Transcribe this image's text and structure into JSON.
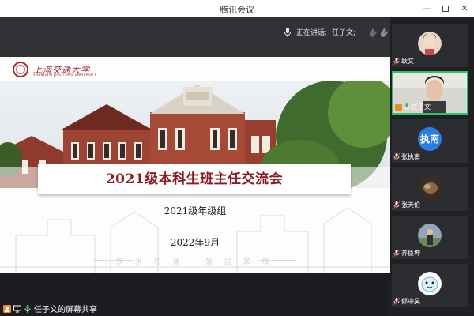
{
  "window": {
    "title": "腾讯会议"
  },
  "topbar": {
    "speaking_prefix": "正在讲话:",
    "speaking_name": "任子文;"
  },
  "slide": {
    "school_name": "上海交通大学",
    "school_name_en": "SHANGHAI JIAO TONG UNIVERSITY",
    "main_title": "2021级本科生班主任交流会",
    "subtitle": "2021级年级组",
    "date": "2022年9月",
    "motto": "饮 水 思 源 · 爱 国 荣 校"
  },
  "share": {
    "label": "任子文的屏幕共享"
  },
  "participants": [
    {
      "name": "耿文",
      "avatar": "photo",
      "active": false
    },
    {
      "name": "任子文",
      "avatar": "photo",
      "active": true
    },
    {
      "name": "张执南",
      "avatar": "text",
      "avatar_text": "执南",
      "active": false
    },
    {
      "name": "张天伦",
      "avatar": "photo",
      "active": false
    },
    {
      "name": "齐臣坤",
      "avatar": "photo",
      "active": false
    },
    {
      "name": "郁中昊",
      "avatar": "cartoon",
      "active": false
    }
  ],
  "colors": {
    "accent_green": "#2ac36a",
    "brand_red": "#a1262a",
    "avatar_blue": "#2a7de1"
  }
}
